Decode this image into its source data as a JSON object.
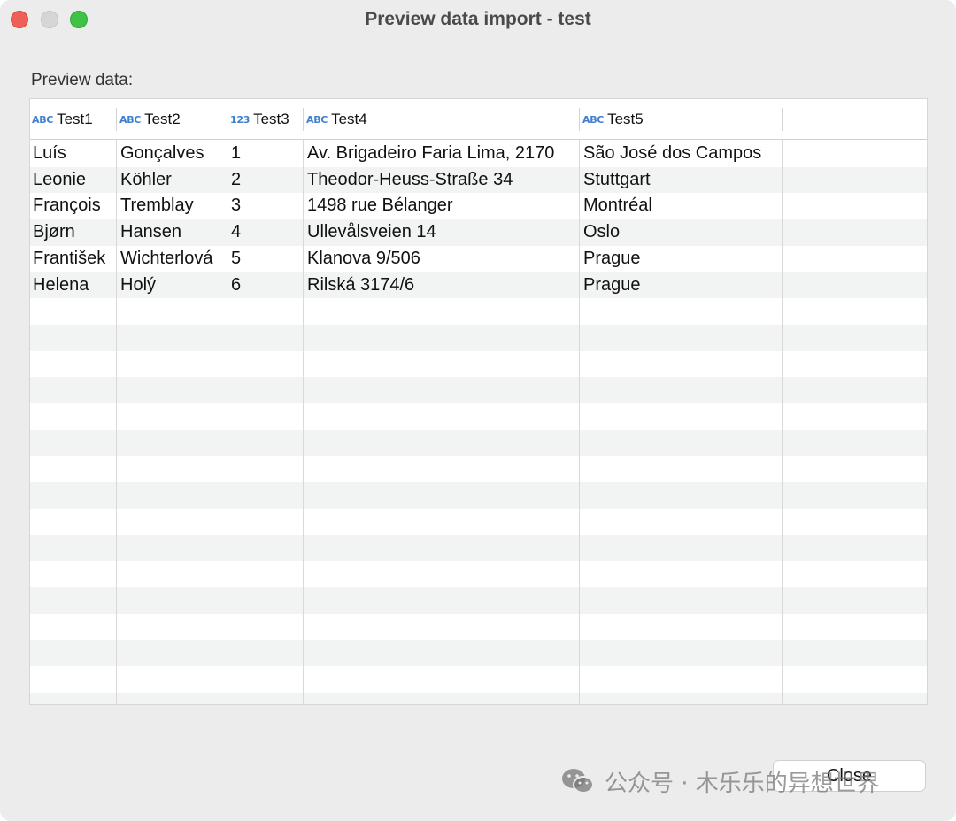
{
  "window": {
    "title": "Preview data import - test"
  },
  "preview_label": "Preview data:",
  "columns": [
    {
      "type_tag": "ABC",
      "name": "Test1"
    },
    {
      "type_tag": "ABC",
      "name": "Test2"
    },
    {
      "type_tag": "123",
      "name": "Test3"
    },
    {
      "type_tag": "ABC",
      "name": "Test4"
    },
    {
      "type_tag": "ABC",
      "name": "Test5"
    }
  ],
  "rows": [
    [
      "Luís",
      "Gonçalves",
      "1",
      "Av. Brigadeiro Faria Lima, 2170",
      "São José dos Campos"
    ],
    [
      "Leonie",
      "Köhler",
      "2",
      "Theodor-Heuss-Straße 34",
      "Stuttgart"
    ],
    [
      "François",
      "Tremblay",
      "3",
      "1498 rue Bélanger",
      "Montréal"
    ],
    [
      "Bjørn",
      "Hansen",
      "4",
      "Ullevålsveien 14",
      "Oslo"
    ],
    [
      "František",
      "Wichterlová",
      "5",
      "Klanova 9/506",
      "Prague"
    ],
    [
      "Helena",
      "Holý",
      "6",
      "Rilská 3174/6",
      "Prague"
    ]
  ],
  "buttons": {
    "close_label": "Close"
  },
  "watermark": {
    "text": "公众号 · 木乐乐的异想世界",
    "icon": "wechat-icon"
  },
  "colors": {
    "type_tag": "#3f7fcf",
    "close_traffic": "#ee5f57",
    "zoom_traffic": "#3fc246"
  }
}
